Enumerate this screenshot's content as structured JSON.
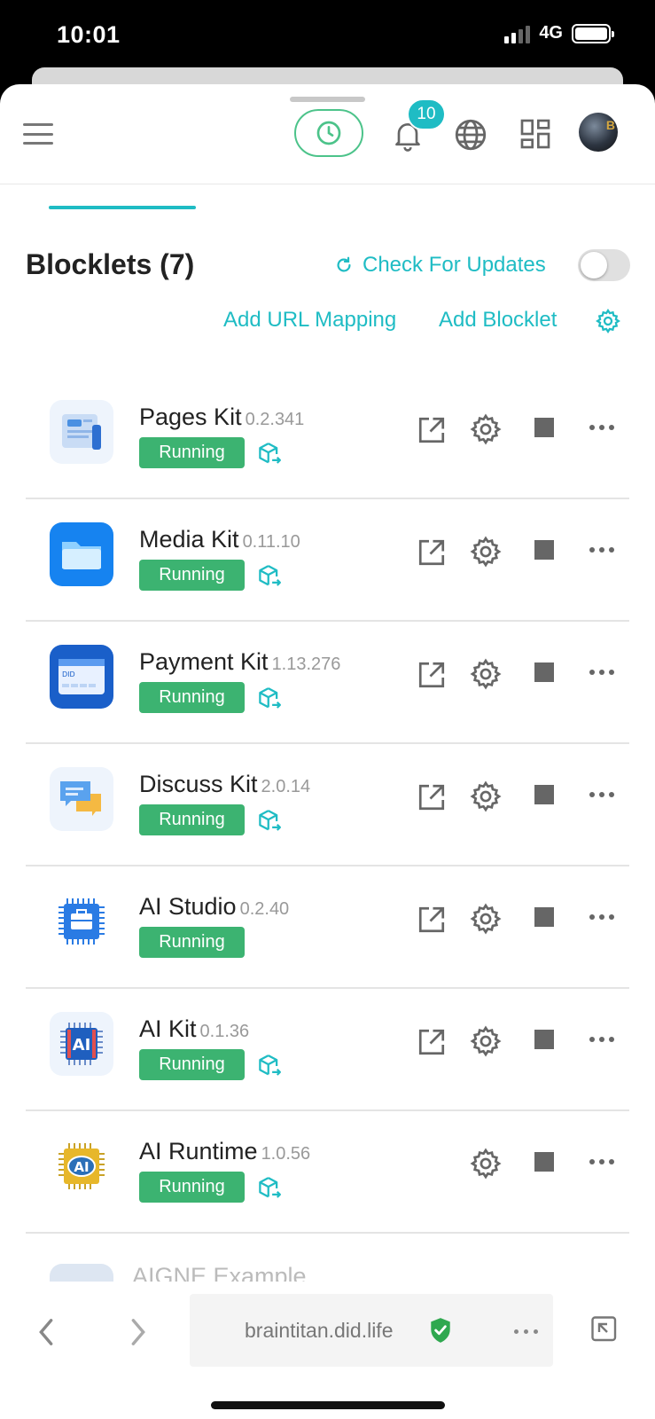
{
  "status_bar": {
    "time": "10:01",
    "network": "4G"
  },
  "header": {
    "notification_count": "10"
  },
  "blocklets_section": {
    "title": "Blocklets (7)",
    "check_updates_label": "Check For Updates",
    "auto_check_enabled": false,
    "add_url_mapping_label": "Add URL Mapping",
    "add_blocklet_label": "Add Blocklet"
  },
  "blocklets": [
    {
      "name": "Pages Kit",
      "version": "0.2.341",
      "status": "Running",
      "logo_icon": "pages-kit-logo"
    },
    {
      "name": "Media Kit",
      "version": "0.11.10",
      "status": "Running",
      "logo_icon": "folder-logo"
    },
    {
      "name": "Payment Kit",
      "version": "1.13.276",
      "status": "Running",
      "logo_icon": "payment-card-logo"
    },
    {
      "name": "Discuss Kit",
      "version": "2.0.14",
      "status": "Running",
      "logo_icon": "chat-bubbles-logo"
    },
    {
      "name": "AI Studio",
      "version": "0.2.40",
      "status": "Running",
      "logo_icon": "ai-studio-chip-logo"
    },
    {
      "name": "AI Kit",
      "version": "0.1.36",
      "status": "Running",
      "logo_icon": "ai-kit-chip-logo"
    },
    {
      "name": "AI Runtime",
      "version": "1.0.56",
      "status": "Running",
      "logo_icon": "ai-runtime-chip-logo"
    }
  ],
  "partial_blocklet": {
    "name": "AIGNE Example"
  },
  "browser": {
    "url": "braintitan.did.life"
  },
  "colors": {
    "accent": "#1fbcc4",
    "running": "#3cb371",
    "clock_border": "#4cc38a"
  }
}
